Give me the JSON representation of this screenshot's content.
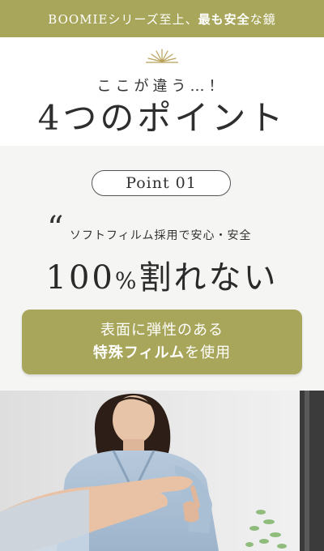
{
  "banner": {
    "part1": "BOOMIEシリーズ至上、",
    "part2": "最も安全",
    "part3": "な鏡"
  },
  "intro": {
    "kicker": "ここが違う…！",
    "headline": "4つのポイント"
  },
  "point": {
    "label": "Point 01",
    "quote_mark": "“",
    "subline": "ソフトフィルム採用で安心・安全",
    "claim_number": "100",
    "claim_percent": "%",
    "claim_text": "割れない"
  },
  "callout": {
    "line1": "表面に弾性のある",
    "line2_bold": "特殊フィルム",
    "line2_rest": "を使用"
  },
  "colors": {
    "accent": "#a8a65a",
    "section_bg": "#f5f5f4",
    "text": "#333333"
  },
  "icons": {
    "sunburst": "sunburst-icon"
  }
}
